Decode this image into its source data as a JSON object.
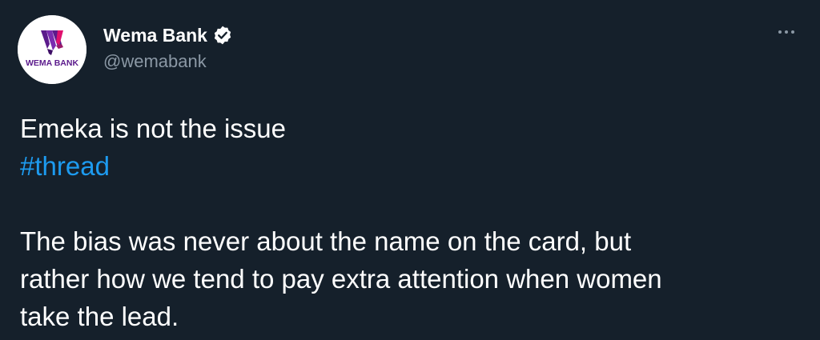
{
  "author": {
    "display_name": "Wema Bank",
    "handle": "@wemabank",
    "verified": true,
    "avatar_logo_text": "WEMA BANK",
    "avatar_colors": {
      "primary": "#5b1a8c",
      "accent": "#e0106e",
      "background": "#ffffff"
    }
  },
  "icons": {
    "verified": "verified-badge-icon",
    "more": "more-options-icon"
  },
  "tweet": {
    "line1": "Emeka is not the issue",
    "hashtag": "#thread",
    "paragraph_lines": [
      "The bias was never about the name on the card, but",
      "rather how we tend to pay extra attention when women",
      "take the lead."
    ]
  },
  "colors": {
    "background": "#15202b",
    "text": "#ffffff",
    "secondary_text": "#8b98a5",
    "link": "#1d9bf0"
  }
}
